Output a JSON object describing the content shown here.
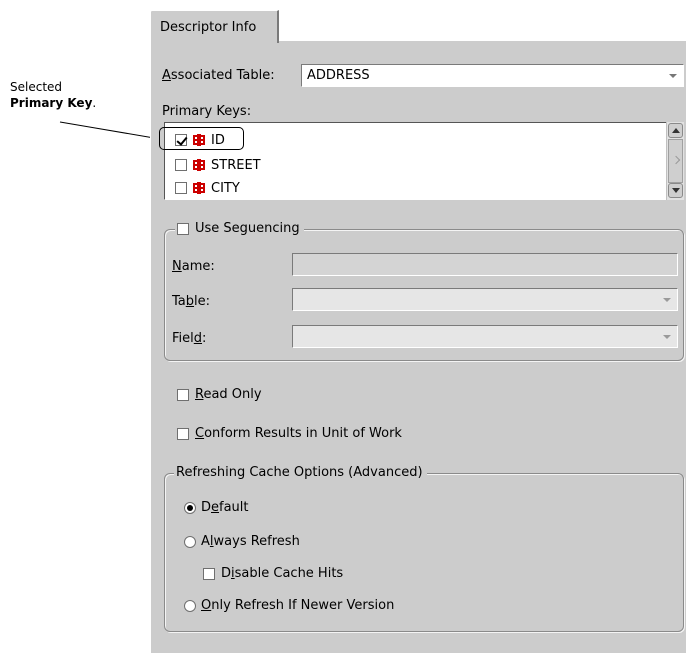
{
  "annotation": {
    "line1": "Selected",
    "line2_bold": "Primary Key",
    "line2_suffix": "."
  },
  "tab": {
    "label": "Descriptor Info"
  },
  "associated_table": {
    "label_prefix": "",
    "label_mnemonic": "A",
    "label_rest": "ssociated Table:",
    "value": "ADDRESS"
  },
  "primary_keys": {
    "label": "Primary Keys:",
    "items": [
      {
        "label": "ID",
        "checked": true
      },
      {
        "label": "STREET",
        "checked": false
      },
      {
        "label": "CITY",
        "checked": false
      }
    ]
  },
  "sequencing": {
    "title": "Use Seguencing",
    "checked": false,
    "name_label_mnemonic": "N",
    "name_label_rest": "ame:",
    "name_value": "",
    "table_label_pre": "Ta",
    "table_label_mnemonic": "b",
    "table_label_rest": "le:",
    "table_value": "",
    "field_label_pre": "Fiel",
    "field_label_mnemonic": "d",
    "field_label_rest": ":",
    "field_value": ""
  },
  "read_only": {
    "mnemonic": "R",
    "rest": "ead Only",
    "checked": false
  },
  "conform": {
    "mnemonic": "C",
    "rest": "onform Results in Unit of Work",
    "checked": false
  },
  "cache": {
    "title": "Refreshing Cache Options (Advanced)",
    "options": [
      {
        "pre": "D",
        "mnemonic": "e",
        "rest": "fault",
        "selected": true
      },
      {
        "pre": "A",
        "mnemonic": "l",
        "rest": "ways Refresh",
        "selected": false
      },
      {
        "pre": "",
        "mnemonic": "O",
        "rest": "nly Refresh If Newer Version",
        "selected": false
      }
    ],
    "disable_hits": {
      "pre": "D",
      "mnemonic": "i",
      "rest": "sable Cache Hits",
      "checked": false
    }
  },
  "colors": {
    "panel": "#cccccc",
    "key_icon": "#cc0000"
  }
}
